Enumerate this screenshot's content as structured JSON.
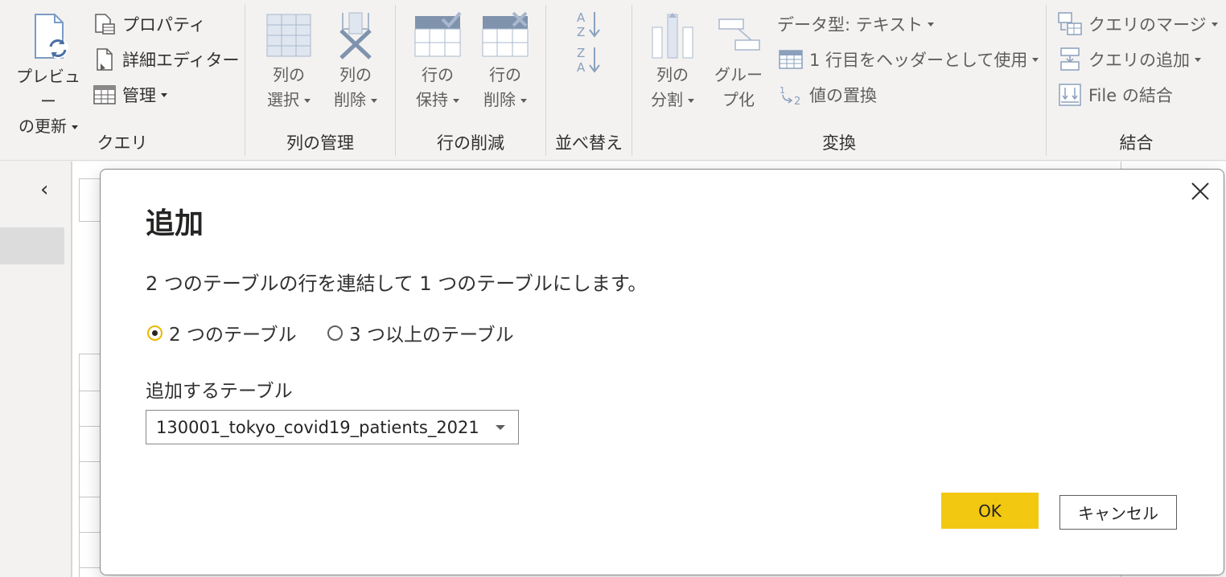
{
  "ribbon": {
    "query": {
      "label": "クエリ",
      "refresh_line1": "プレビュー",
      "refresh_line2": "の更新",
      "properties": "プロパティ",
      "advanced_editor": "詳細エディター",
      "manage": "管理"
    },
    "manage_columns": {
      "label": "列の管理",
      "choose_line1": "列の",
      "choose_line2": "選択",
      "remove_line1": "列の",
      "remove_line2": "削除"
    },
    "reduce_rows": {
      "label": "行の削減",
      "keep_line1": "行の",
      "keep_line2": "保持",
      "remove_line1": "行の",
      "remove_line2": "削除"
    },
    "sort": {
      "label": "並べ替え"
    },
    "transform": {
      "label": "変換",
      "split_line1": "列の",
      "split_line2": "分割",
      "group_line1": "グルー",
      "group_line2": "プ化",
      "data_type": "データ型: テキスト",
      "use_first_row": "1 行目をヘッダーとして使用",
      "replace_values": "値の置換"
    },
    "combine": {
      "label": "結合",
      "merge": "クエリのマージ",
      "append": "クエリの追加",
      "combine_files": "File の結合"
    }
  },
  "dialog": {
    "title": "追加",
    "description": "2 つのテーブルの行を連結して 1 つのテーブルにします。",
    "options": [
      {
        "label": "2 つのテーブル",
        "checked": true
      },
      {
        "label": "3 つ以上のテーブル",
        "checked": false
      }
    ],
    "table_label": "追加するテーブル",
    "selected_table": "130001_tokyo_covid19_patients_2021",
    "ok_label": "OK",
    "cancel_label": "キャンセル"
  },
  "colors": {
    "accent": "#f2c811",
    "ribbon_bg": "#f3f2f1",
    "icon_blue": "#4a6fa5"
  }
}
